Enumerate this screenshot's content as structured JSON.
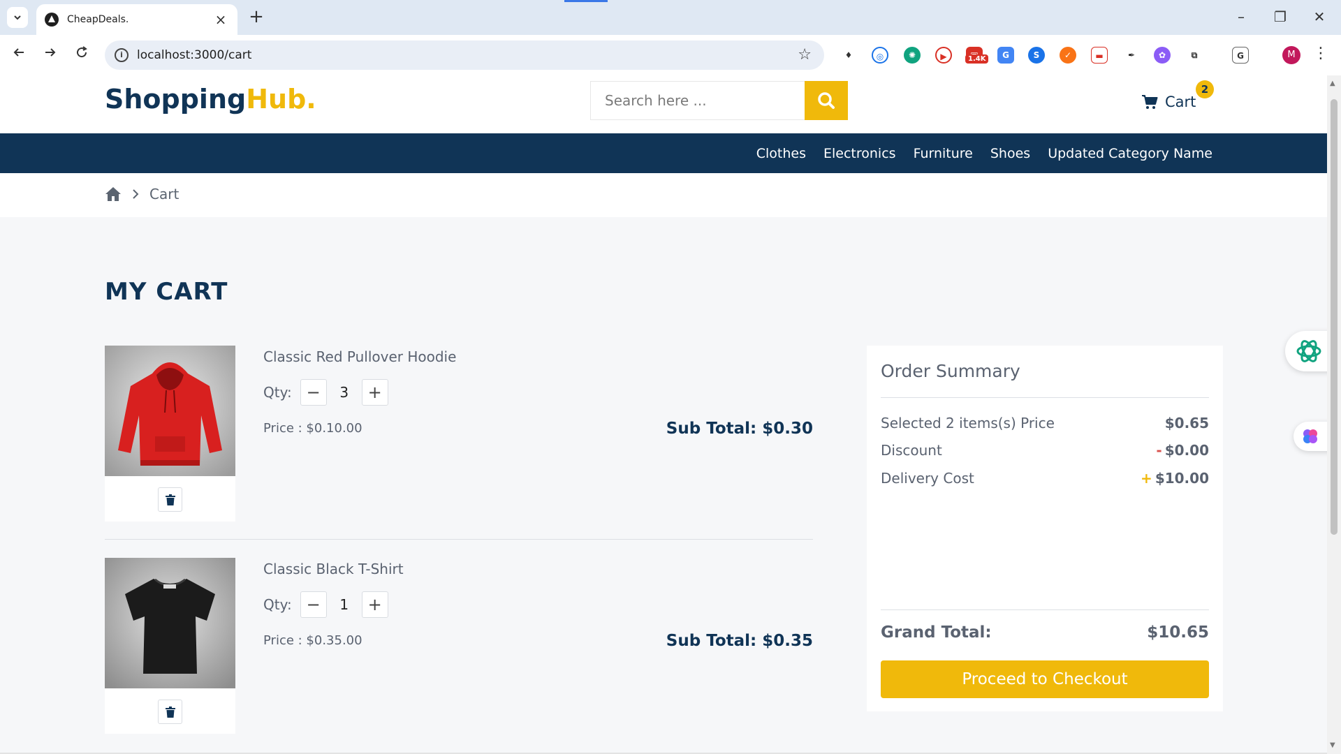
{
  "browser": {
    "tab_title": "CheapDeals.",
    "url": "localhost:3000/cart",
    "extension_badge": "1.4K",
    "profile_initial": "M"
  },
  "site": {
    "logo_part1": "Shopping",
    "logo_part2": "Hub.",
    "search_placeholder": "Search here ...",
    "cart_label": "Cart",
    "cart_count": "2"
  },
  "nav": {
    "items": [
      "Clothes",
      "Electronics",
      "Furniture",
      "Shoes",
      "Updated Category Name"
    ]
  },
  "breadcrumb": {
    "current": "Cart"
  },
  "cart": {
    "title": "MY CART",
    "qty_label": "Qty:",
    "items": [
      {
        "name": "Classic Red Pullover Hoodie",
        "qty": "3",
        "price": "Price : $0.10.00",
        "subtotal": "Sub Total: $0.30"
      },
      {
        "name": "Classic Black T-Shirt",
        "qty": "1",
        "price": "Price : $0.35.00",
        "subtotal": "Sub Total: $0.35"
      }
    ]
  },
  "summary": {
    "heading": "Order Summary",
    "rows": [
      {
        "label": "Selected 2 items(s) Price",
        "sign": "",
        "value": "$0.65"
      },
      {
        "label": "Discount",
        "sign": "-",
        "value": "$0.00"
      },
      {
        "label": "Delivery Cost",
        "sign": "+",
        "value": "$10.00"
      }
    ],
    "grand_label": "Grand Total:",
    "grand_value": "$10.65",
    "checkout_label": "Proceed to Checkout"
  },
  "colors": {
    "brand_navy": "#103456",
    "accent_yellow": "#f0b90b",
    "discount_sign": "#d9534f",
    "delivery_sign": "#f0b90b"
  },
  "icons": {
    "tab_search": "chevron-down-icon",
    "favicon": "triangle-logo-icon",
    "search": "search-icon",
    "cart": "cart-icon",
    "home": "home-icon",
    "delete": "trash-icon",
    "assistant": "openai-icon",
    "brain": "brain-icon"
  }
}
